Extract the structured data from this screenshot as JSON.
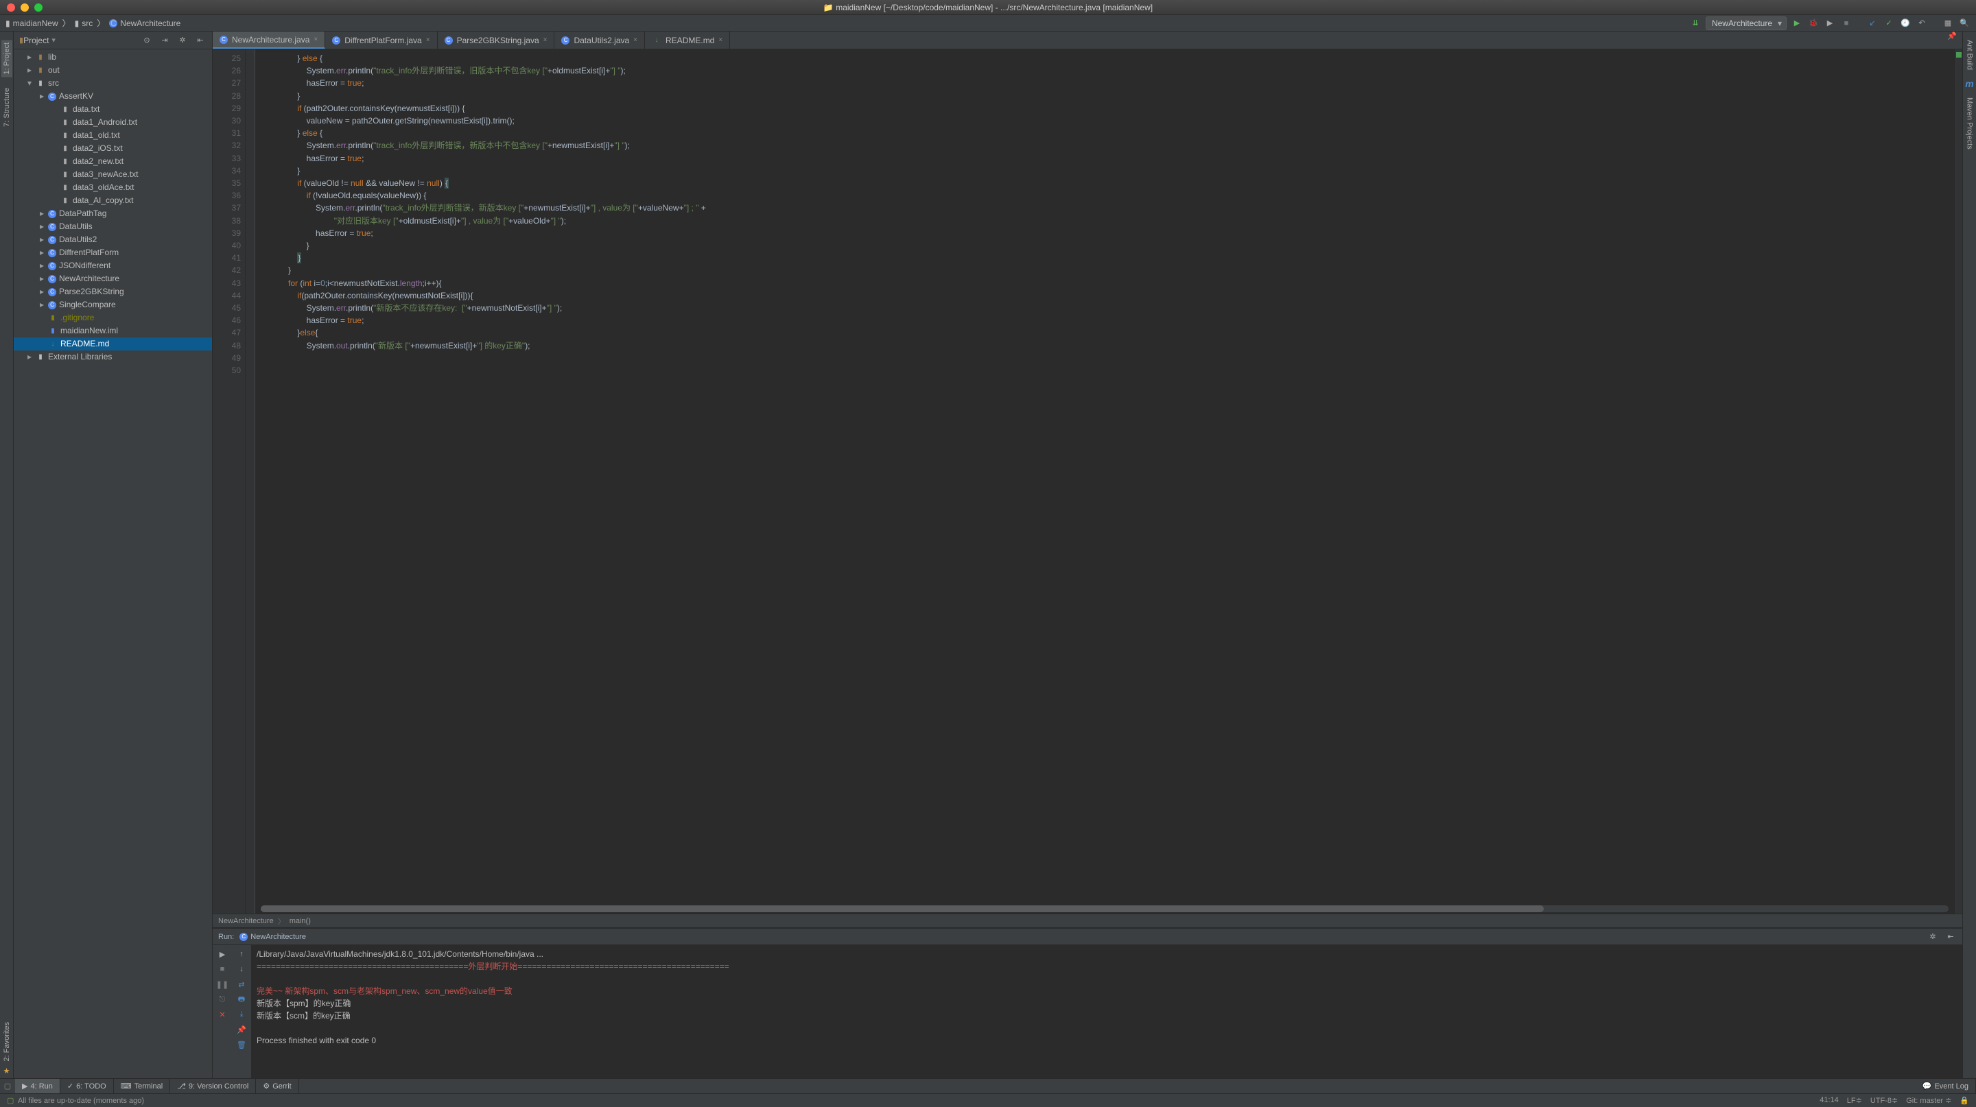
{
  "window_title": "maidianNew [~/Desktop/code/maidianNew] - .../src/NewArchitecture.java [maidianNew]",
  "breadcrumbs": {
    "p1": "maidianNew",
    "p2": "src",
    "p3": "NewArchitecture"
  },
  "run_config": "NewArchitecture",
  "sidebar": {
    "title": "Project",
    "tree": [
      {
        "depth": 0,
        "arrow": "▸",
        "kind": "dir",
        "label": "lib"
      },
      {
        "depth": 0,
        "arrow": "▸",
        "kind": "dir",
        "label": "out"
      },
      {
        "depth": 0,
        "arrow": "▾",
        "kind": "src",
        "label": "src"
      },
      {
        "depth": 1,
        "arrow": "▸",
        "kind": "jclass",
        "label": "AssertKV"
      },
      {
        "depth": 2,
        "arrow": "",
        "kind": "txt",
        "label": "data.txt"
      },
      {
        "depth": 2,
        "arrow": "",
        "kind": "txt",
        "label": "data1_Android.txt"
      },
      {
        "depth": 2,
        "arrow": "",
        "kind": "txt",
        "label": "data1_old.txt"
      },
      {
        "depth": 2,
        "arrow": "",
        "kind": "txt",
        "label": "data2_iOS.txt"
      },
      {
        "depth": 2,
        "arrow": "",
        "kind": "txt",
        "label": "data2_new.txt"
      },
      {
        "depth": 2,
        "arrow": "",
        "kind": "txt",
        "label": "data3_newAce.txt"
      },
      {
        "depth": 2,
        "arrow": "",
        "kind": "txt",
        "label": "data3_oldAce.txt"
      },
      {
        "depth": 2,
        "arrow": "",
        "kind": "txt",
        "label": "data_AI_copy.txt"
      },
      {
        "depth": 1,
        "arrow": "▸",
        "kind": "jclass",
        "label": "DataPathTag"
      },
      {
        "depth": 1,
        "arrow": "▸",
        "kind": "jclass",
        "label": "DataUtils"
      },
      {
        "depth": 1,
        "arrow": "▸",
        "kind": "jclass",
        "label": "DataUtils2"
      },
      {
        "depth": 1,
        "arrow": "▸",
        "kind": "jclass",
        "label": "DiffrentPlatForm"
      },
      {
        "depth": 1,
        "arrow": "▸",
        "kind": "jclass",
        "label": "JSONdifferent"
      },
      {
        "depth": 1,
        "arrow": "▸",
        "kind": "jclass",
        "label": "NewArchitecture"
      },
      {
        "depth": 1,
        "arrow": "▸",
        "kind": "jclass",
        "label": "Parse2GBKString"
      },
      {
        "depth": 1,
        "arrow": "▸",
        "kind": "jclass",
        "label": "SingleCompare"
      },
      {
        "depth": 1,
        "arrow": "",
        "kind": "ign",
        "label": ".gitignore"
      },
      {
        "depth": 1,
        "arrow": "",
        "kind": "module",
        "label": "maidianNew.iml"
      },
      {
        "depth": 1,
        "arrow": "",
        "kind": "md",
        "label": "README.md",
        "sel": true
      },
      {
        "depth": -1,
        "arrow": "▸",
        "kind": "lib",
        "label": "External Libraries"
      }
    ]
  },
  "tabs": [
    {
      "label": "NewArchitecture.java",
      "active": true,
      "kind": "jclass"
    },
    {
      "label": "DiffrentPlatForm.java",
      "kind": "jclass"
    },
    {
      "label": "Parse2GBKString.java",
      "kind": "jclass"
    },
    {
      "label": "DataUtils2.java",
      "kind": "jclass"
    },
    {
      "label": "README.md",
      "kind": "md"
    }
  ],
  "editor": {
    "first_line": 25,
    "last_line": 50,
    "lines": [
      "                } else {",
      "                    System.err.println(\"track_info外层判断错误，旧版本中不包含key [\"+oldmustExist[i]+\"] \");",
      "                    hasError = true;",
      "                }",
      "                if (path2Outer.containsKey(newmustExist[i])) {",
      "                    valueNew = path2Outer.getString(newmustExist[i]).trim();",
      "                } else {",
      "                    System.err.println(\"track_info外层判断错误，新版本中不包含key [\"+newmustExist[i]+\"] \");",
      "                    hasError = true;",
      "                }",
      "                if (valueOld != null && valueNew != null) {",
      "                    if (!valueOld.equals(valueNew)) {",
      "                        System.err.println(\"track_info外层判断错误，新版本key [\"+newmustExist[i]+\"] , value为 [\"+valueNew+\"] ; \" +",
      "                                \"对应旧版本key [\"+oldmustExist[i]+\"] , value为 [\"+valueOld+\"] \");",
      "                        hasError = true;",
      "                    }",
      "                }",
      "            }",
      "",
      "            for (int i=0;i<newmustNotExist.length;i++){",
      "                if(path2Outer.containsKey(newmustNotExist[i])){",
      "                    System.err.println(\"新版本不应该存在key:  [\"+newmustNotExist[i]+\"] \");",
      "                    hasError = true;",
      "                }else{",
      "                    System.out.println(\"新版本 [\"+newmustExist[i]+\"] 的key正确\");",
      ""
    ]
  },
  "crumb2": {
    "c1": "NewArchitecture",
    "c2": "main()"
  },
  "run": {
    "label": "Run:",
    "config": "NewArchitecture",
    "lines": [
      {
        "text": "/Library/Java/JavaVirtualMachines/jdk1.8.0_101.jdk/Contents/Home/bin/java ..."
      },
      {
        "text": "============================================外层判断开始============================================",
        "cls": "red"
      },
      {
        "text": ""
      },
      {
        "text": "完美~~  新架构spm、scm与老架构spm_new、scm_new的value值一致",
        "cls": "red"
      },
      {
        "text": "新版本【spm】的key正确"
      },
      {
        "text": "新版本【scm】的key正确"
      },
      {
        "text": ""
      },
      {
        "text": "Process finished with exit code 0"
      }
    ]
  },
  "bottom": [
    {
      "icon": "▶",
      "label": "4: Run",
      "active": true
    },
    {
      "icon": "✓",
      "label": "6: TODO"
    },
    {
      "icon": "⌨",
      "label": "Terminal"
    },
    {
      "icon": "⎇",
      "label": "9: Version Control"
    },
    {
      "icon": "⚙",
      "label": "Gerrit"
    }
  ],
  "event_log": "Event Log",
  "status": {
    "msg": "All files are up-to-date (moments ago)",
    "pos": "41:14",
    "le": "LF≑",
    "enc": "UTF-8≑",
    "git": "Git: master ≑",
    "lock": "🔒"
  },
  "rails": {
    "left": [
      "1: Project",
      "7: Structure",
      "2: Favorites"
    ],
    "right": [
      "Ant Build",
      "m",
      "Maven Projects"
    ]
  }
}
